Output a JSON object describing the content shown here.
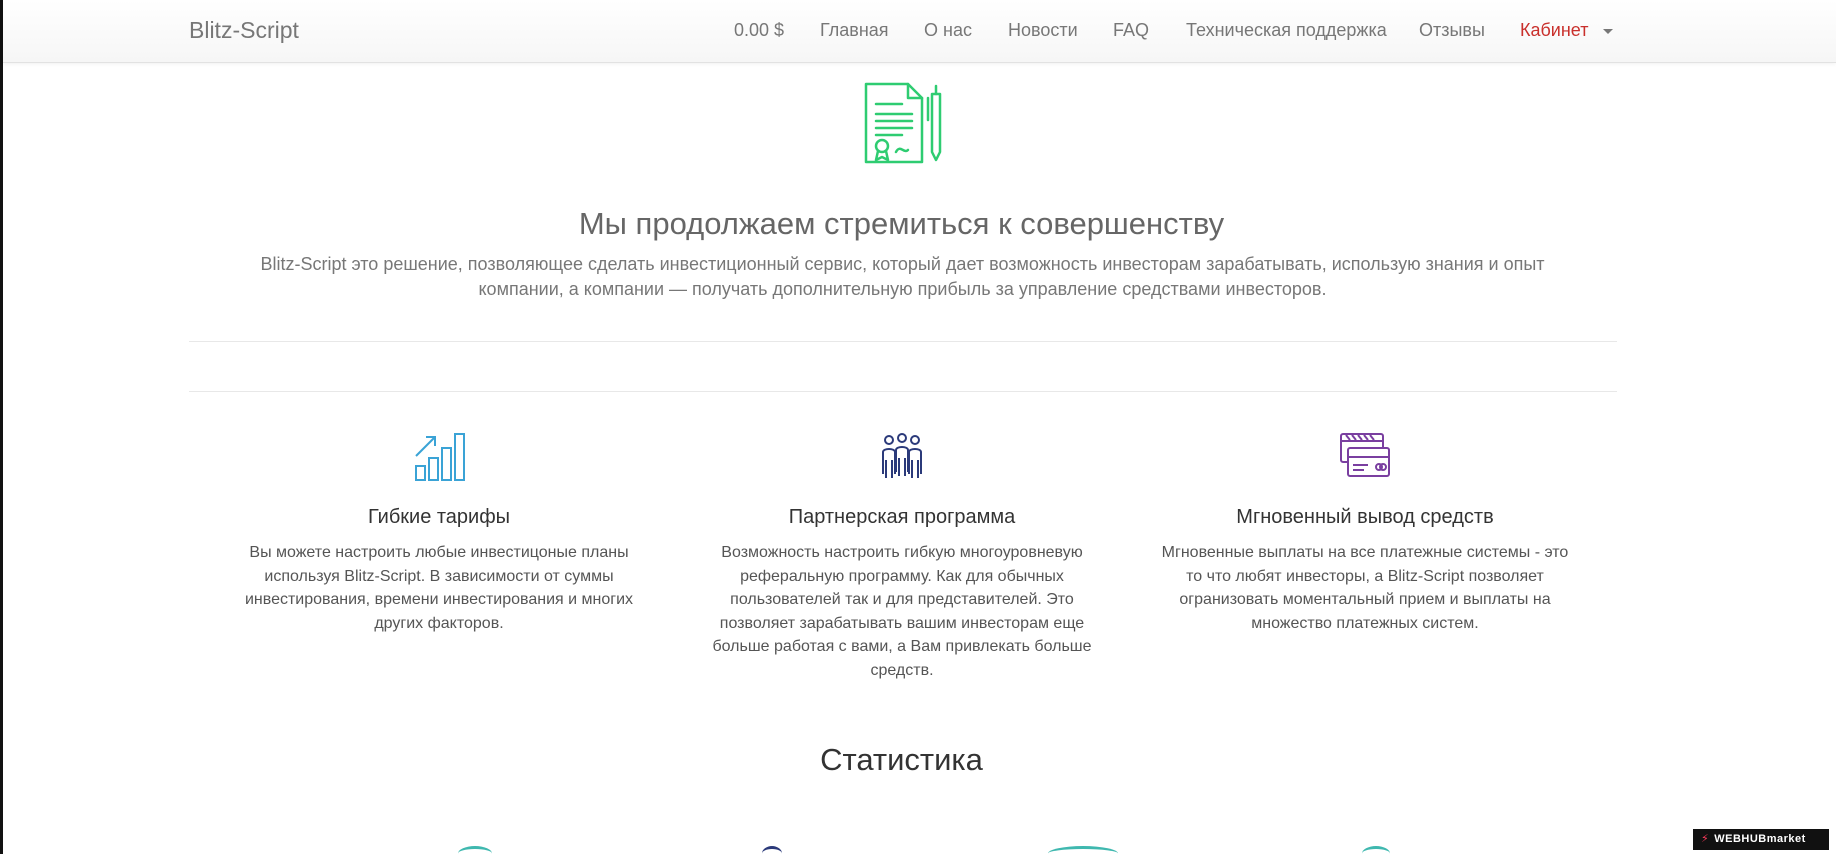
{
  "navbar": {
    "brand": "Blitz-Script",
    "balance": "0.00 $",
    "items": [
      {
        "label": "Главная"
      },
      {
        "label": "О нас"
      },
      {
        "label": "Новости"
      },
      {
        "label": "FAQ"
      },
      {
        "label": "Техническая поддержка"
      },
      {
        "label": "Отзывы"
      }
    ],
    "cabinet": "Кабинет"
  },
  "hero": {
    "icon": "contract-document-icon",
    "title": "Мы продолжаем стремиться к совершенству",
    "text": "Blitz-Script это решение, позволяющее сделать инвестиционный сервис, который дает возможность инвесторам зарабатывать, использую знания и опыт компании, а компании — получать дополнительную прибыль за управление средствами инвесторов."
  },
  "features": [
    {
      "icon": "growth-chart-icon",
      "color": "#3aa3d6",
      "title": "Гибкие тарифы",
      "text": "Вы можете настроить любые инвестицоные планы используя Blitz-Script. В зависимости от суммы инвестирования, времени инвестирования и многих других факторов."
    },
    {
      "icon": "people-group-icon",
      "color": "#2b3a7a",
      "title": "Партнерская программа",
      "text": "Возможность настроить гибкую многоуровневую реферальную программу. Как для обычных пользователей так и для представителей. Это позволяет зарабатывать вашим инвесторам еще больше работая с вами, а Вам привлекать больше средств."
    },
    {
      "icon": "credit-cards-icon",
      "color": "#7a3fa0",
      "title": "Мгновенный вывод средств",
      "text": "Мгновенные выплаты на все платежные системы - это то что любят инвесторы, а Blitz-Script позволяет огранизовать моментальный прием и выплаты на множество платежных систем."
    }
  ],
  "stats": {
    "title": "Статистика"
  },
  "colors": {
    "accent_green": "#2ecc71",
    "cabinet_red": "#c9302c",
    "stats_teal": "#3fb8af"
  },
  "badge": {
    "text": "WEBHUBmarket"
  }
}
